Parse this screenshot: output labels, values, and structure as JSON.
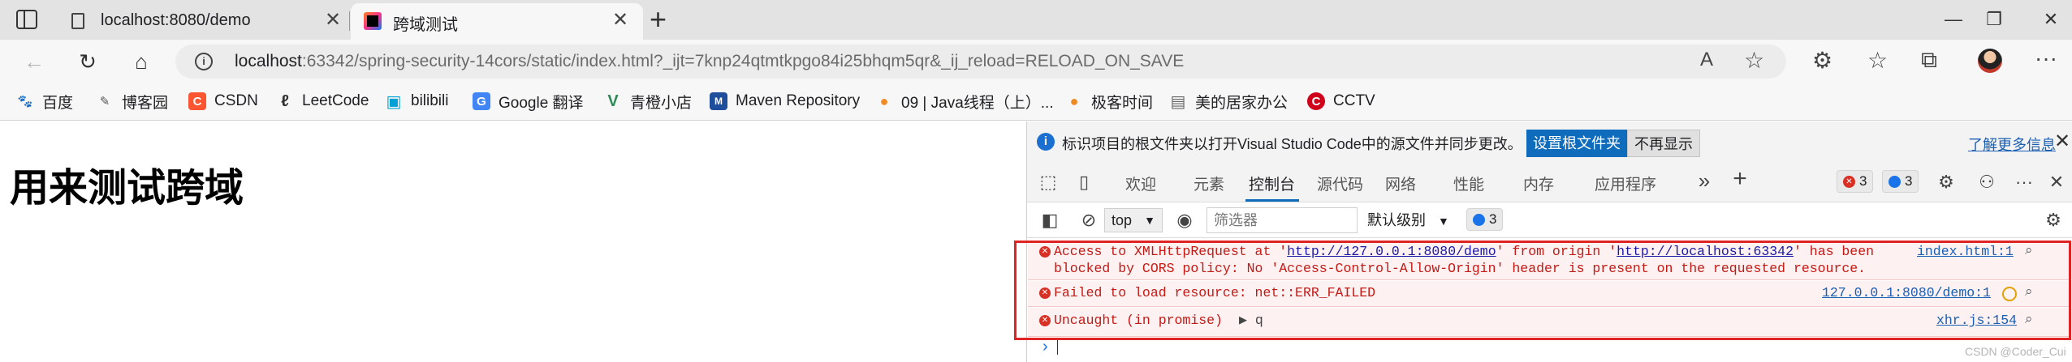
{
  "browser": {
    "tabs": [
      {
        "title": "localhost:8080/demo",
        "favicon": "page-icon",
        "active": false
      },
      {
        "title": "跨域测试",
        "favicon": "jetbrains-icon",
        "active": true
      }
    ],
    "new_tab_symbol": "+",
    "window_controls": [
      "—",
      "❐",
      "✕"
    ],
    "address": {
      "host": "localhost",
      "rest": ":63342/spring-security-14cors/static/index.html?_ijt=7knp24qtmtkpgo84i25bhqm5qr&_ij_reload=RELOAD_ON_SAVE",
      "read_aloud_symbol": "A"
    },
    "bookmarks": [
      {
        "label": "百度",
        "icon": "baidu-icon",
        "color": "#2932e1",
        "glyph": "🐾"
      },
      {
        "label": "博客园",
        "icon": "cnblogs-icon",
        "color": "#555555",
        "glyph": "✎"
      },
      {
        "label": "CSDN",
        "icon": "csdn-icon",
        "color": "#fc5531",
        "glyph": "C"
      },
      {
        "label": "LeetCode",
        "icon": "leetcode-icon",
        "color": "#333333",
        "glyph": "ℓ"
      },
      {
        "label": "bilibili",
        "icon": "bilibili-icon",
        "color": "#00a1d6",
        "glyph": "▣"
      },
      {
        "label": "Google 翻译",
        "icon": "google-translate-icon",
        "color": "#4285f4",
        "glyph": "G"
      },
      {
        "label": "青橙小店",
        "icon": "vue-icon",
        "color": "#2e8b57",
        "glyph": "V"
      },
      {
        "label": "Maven Repository",
        "icon": "maven-icon",
        "color": "#1f4f9c",
        "glyph": "M"
      },
      {
        "label": "09 | Java线程（上）...",
        "icon": "geektime-icon",
        "color": "#f08a24",
        "glyph": "●"
      },
      {
        "label": "极客时间",
        "icon": "geektime-icon-2",
        "color": "#f08a24",
        "glyph": "●"
      },
      {
        "label": "美的居家办公",
        "icon": "document-icon",
        "color": "#666666",
        "glyph": "▤"
      },
      {
        "label": "CCTV",
        "icon": "cctv-icon",
        "color": "#d0021b",
        "glyph": "C"
      }
    ]
  },
  "page": {
    "heading": "用来测试跨域"
  },
  "devtools": {
    "infobar": {
      "info_symbol": "i",
      "message": "标识项目的根文件夹以打开Visual Studio Code中的源文件并同步更改。",
      "primary_button": "设置根文件夹",
      "secondary_button": "不再显示",
      "link": "了解更多信息",
      "close_symbol": "✕"
    },
    "tabs": [
      "欢迎",
      "元素",
      "控制台",
      "源代码",
      "网络",
      "性能",
      "内存",
      "应用程序"
    ],
    "more_symbol": "»",
    "add_symbol": "+",
    "error_count": "3",
    "info_count": "3",
    "console_toolbar": {
      "context": "top",
      "filter_placeholder": "筛选器",
      "level": "默认级别",
      "message_count": "3"
    },
    "messages": [
      {
        "text_a": "Access to XMLHttpRequest at '",
        "url_a": "http://127.0.0.1:8080/demo",
        "text_b": "' from origin '",
        "url_b": "http://localhost:63342",
        "text_c": "' has been",
        "line2": "blocked by CORS policy: No 'Access-Control-Allow-Origin' header is present on the requested resource.",
        "source": "index.html:1"
      },
      {
        "text": "Failed to load resource: net::ERR_FAILED",
        "source": "127.0.0.1:8080/demo:1"
      },
      {
        "text": "Uncaught (in promise)",
        "expand": "▶ q",
        "source": "xhr.js:154"
      }
    ],
    "prompt_symbol": "›"
  },
  "watermark": "CSDN @Coder_Cui",
  "colors": {
    "accent": "#0f6cbd",
    "error": "#c41a16",
    "error_bg": "#fdf1f1",
    "highlight_box": "#e02424"
  }
}
